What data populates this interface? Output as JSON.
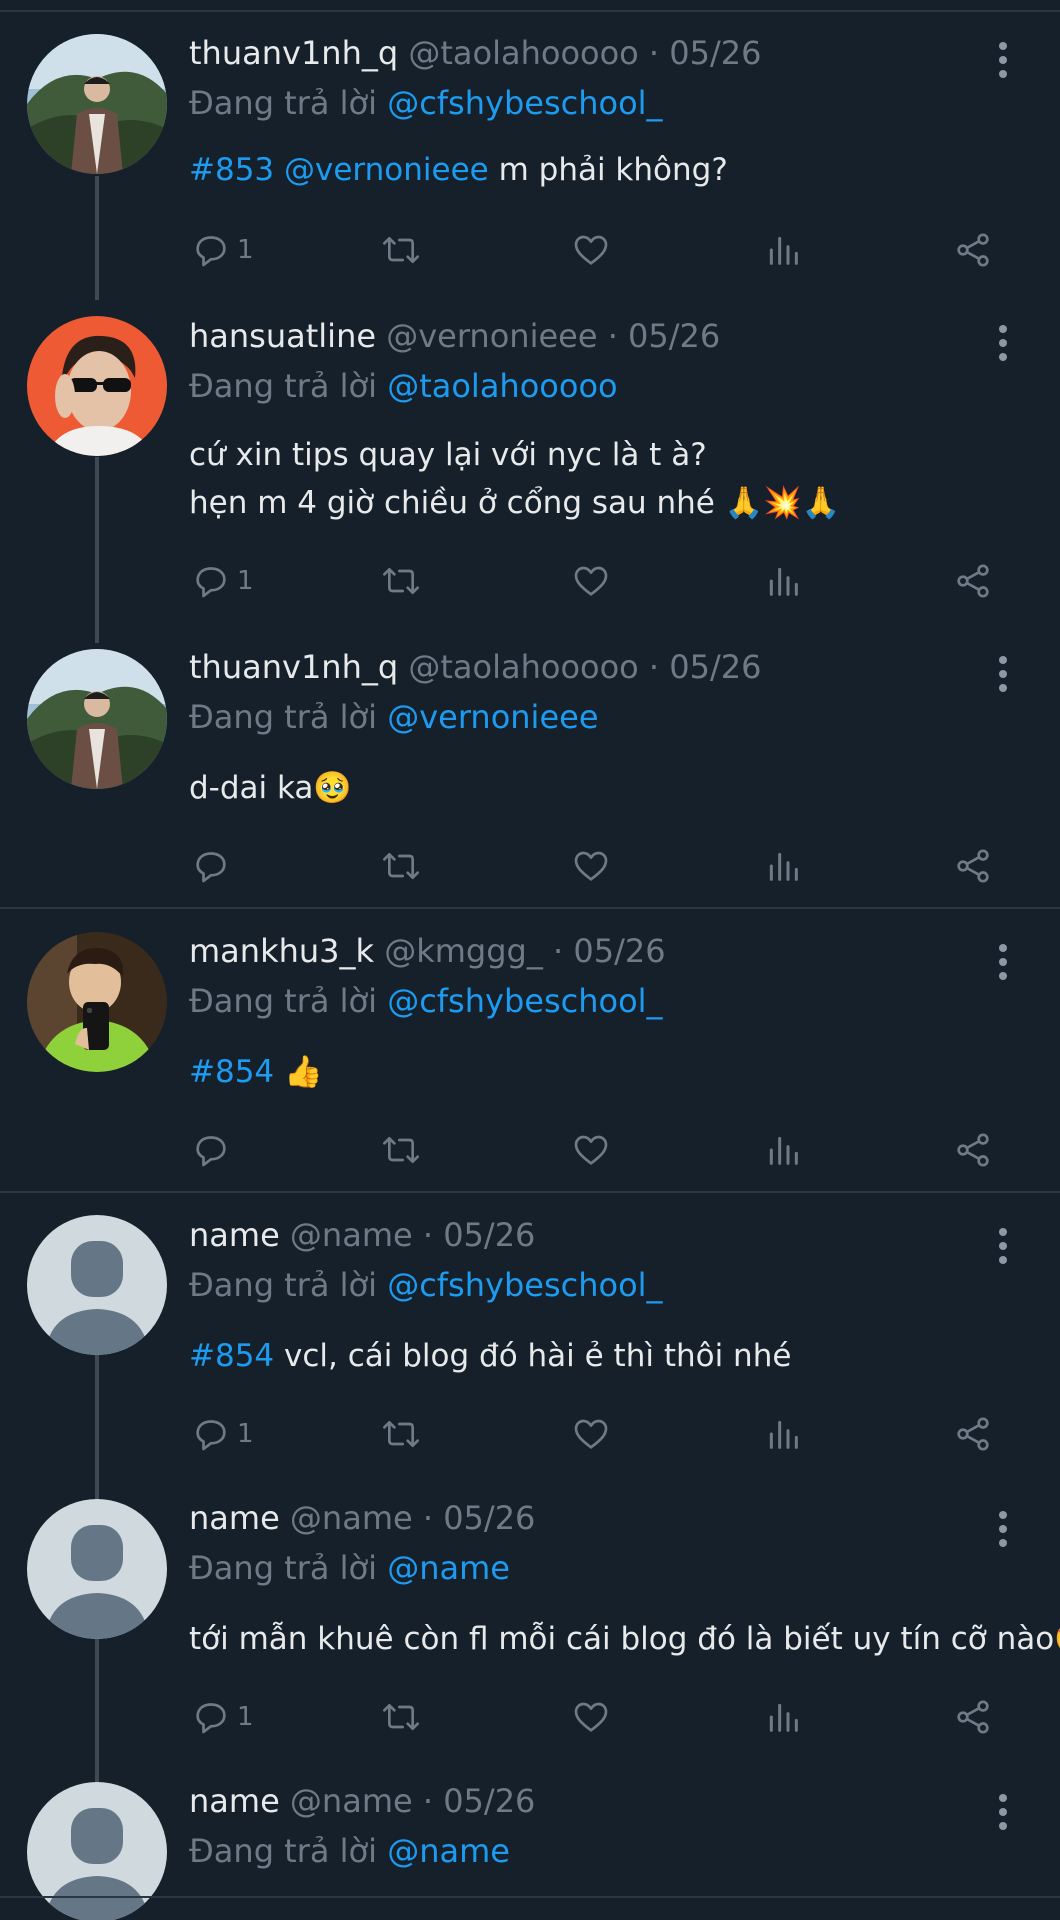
{
  "colors": {
    "background": "#15202b",
    "accent": "#1d9bf0",
    "muted": "#6e7b87",
    "text": "#e7e9ea"
  },
  "reply_prefix": "Đang trả lời",
  "tweets": [
    {
      "name": "thuanv1nh_q",
      "handle": "@taolahooooo",
      "sep": "·",
      "date": "05/26",
      "reply_to": "@cfshybeschool_",
      "body_parts": [
        {
          "text": "#853",
          "link": true
        },
        {
          "text": " ",
          "link": false
        },
        {
          "text": "@vernonieee",
          "link": true
        },
        {
          "text": " m phải không?",
          "link": false
        }
      ],
      "reply_count": "1"
    },
    {
      "name": "hansuatline",
      "handle": "@vernonieee",
      "sep": "·",
      "date": "05/26",
      "reply_to": "@taolahooooo",
      "line1": "cứ xin tips quay lại với nyc là t à?",
      "line2": "hẹn m 4 giờ chiều ở cổng sau nhé 🙏💥🙏",
      "reply_count": "1"
    },
    {
      "name": "thuanv1nh_q",
      "handle": "@taolahooooo",
      "sep": "·",
      "date": "05/26",
      "reply_to": "@vernonieee",
      "line1": "d-dai ka🥹",
      "reply_count": ""
    },
    {
      "name": "mankhu3_k",
      "handle": "@kmggg_",
      "sep": "·",
      "date": "05/26",
      "reply_to": "@cfshybeschool_",
      "tag": "#854",
      "rest": " 👍",
      "reply_count": ""
    },
    {
      "name": "name",
      "handle": "@name",
      "sep": "·",
      "date": "05/26",
      "reply_to": "@cfshybeschool_",
      "tag": "#854",
      "rest": " vcl, cái blog đó hài ẻ thì thôi nhé",
      "reply_count": "1"
    },
    {
      "name": "name",
      "handle": "@name",
      "sep": "·",
      "date": "05/26",
      "reply_to": "@name",
      "line1": "tới mẫn khuê còn fl mỗi cái blog đó là biết uy tín cỡ nào🤩",
      "reply_count": "1"
    },
    {
      "name": "name",
      "handle": "@name",
      "sep": "·",
      "date": "05/26",
      "reply_to": "@name"
    }
  ]
}
